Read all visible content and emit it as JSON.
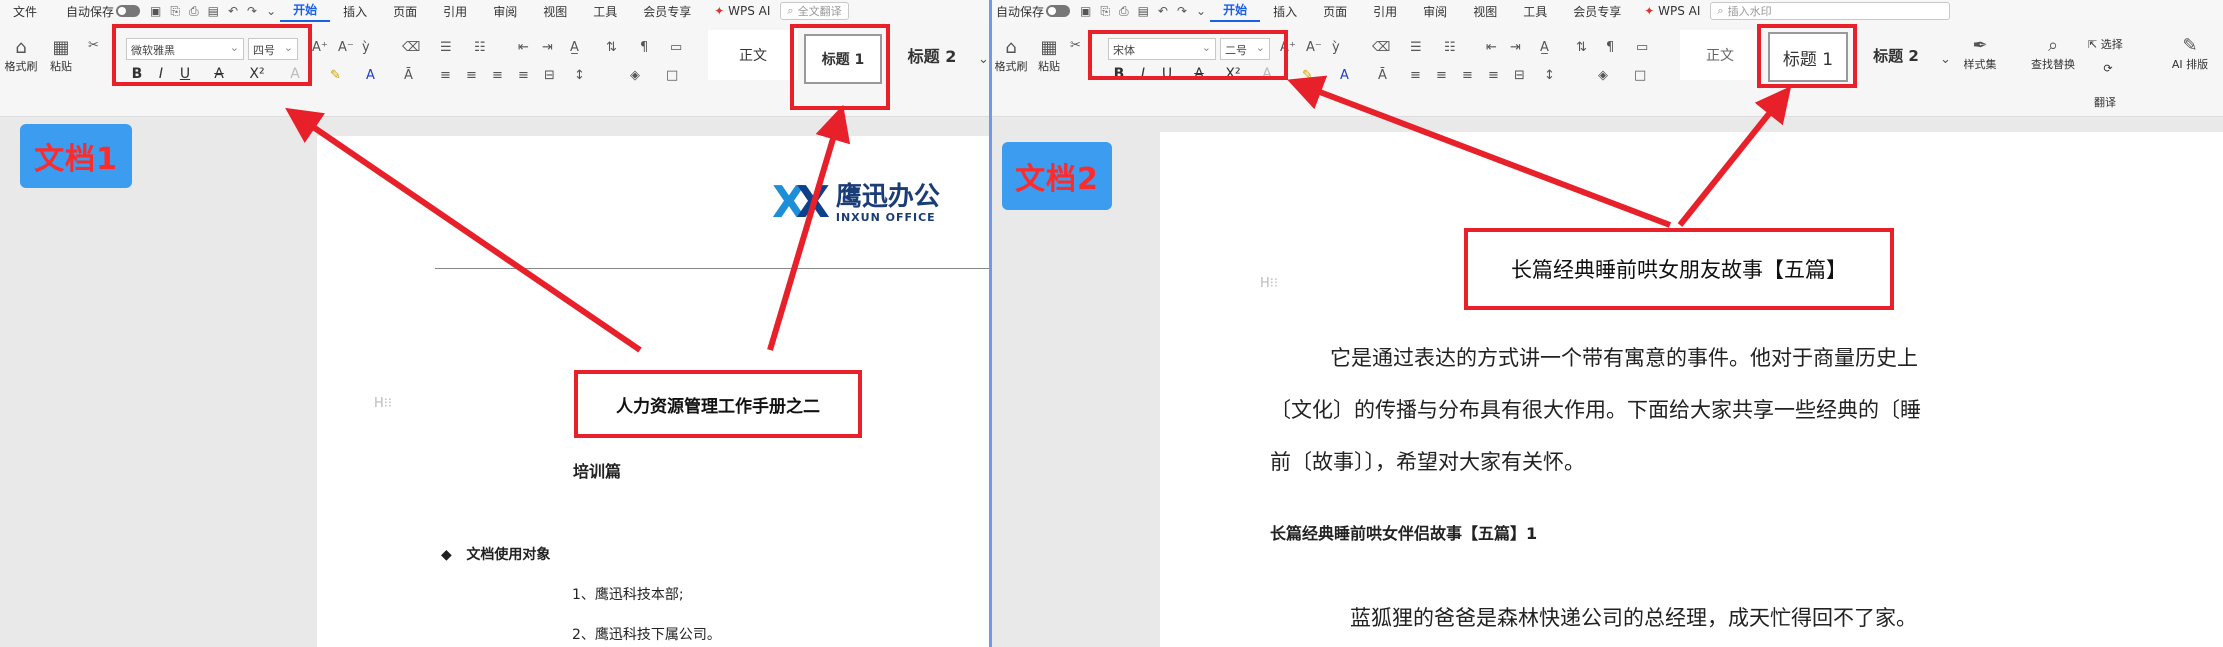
{
  "doc1": {
    "menubar": {
      "file": "文件",
      "autosave": "自动保存",
      "tabs": [
        "开始",
        "插入",
        "页面",
        "引用",
        "审阅",
        "视图",
        "工具",
        "会员专享"
      ],
      "wps_ai": "WPS AI",
      "search_placeholder": "全文翻译"
    },
    "ribbon": {
      "format_painter": "格式刷",
      "paste": "粘贴",
      "font_name": "微软雅黑",
      "font_size": "四号",
      "style_normal": "正文",
      "style_heading1": "标题 1",
      "style_heading2": "标题 2"
    },
    "badge": "文档1",
    "logo": {
      "cn": "鹰迅办公",
      "en": "INXUN OFFICE"
    },
    "title_callout": "人力资源管理工作手册之二",
    "subtitle": "培训篇",
    "bullet_heading": "文档使用对象",
    "list_items": [
      "1、鹰迅科技本部;",
      "2、鹰迅科技下属公司。"
    ]
  },
  "doc2": {
    "menubar": {
      "autosave": "自动保存",
      "tabs": [
        "开始",
        "插入",
        "页面",
        "引用",
        "审阅",
        "视图",
        "工具",
        "会员专享"
      ],
      "wps_ai": "WPS AI",
      "search_placeholder": "插入水印"
    },
    "ribbon": {
      "format_painter": "格式刷",
      "paste": "粘贴",
      "font_name": "宋体",
      "font_size": "二号",
      "style_normal": "正文",
      "style_heading1": "标题 1",
      "style_heading2": "标题 2",
      "style_set": "样式集",
      "find_replace": "查找替换",
      "select": "选择",
      "translate": "翻译",
      "ai_layout": "AI 排版"
    },
    "badge": "文档2",
    "title_callout": "长篇经典睡前哄女朋友故事【五篇】",
    "paragraph_lines": [
      "它是通过表达的方式讲一个带有寓意的事件。他对于商量历史上",
      "〔文化〕的传播与分布具有很大作用。下面给大家共享一些经典的〔睡",
      "前〔故事〕〕，希望对大家有关怀。"
    ],
    "heading": "长篇经典睡前哄女伴侣故事【五篇】1",
    "last_line": "蓝狐狸的爸爸是森林快递公司的总经理，成天忙得回不了家。"
  },
  "colors": {
    "accent_red": "#e8202a",
    "badge_blue": "#3b9cf0",
    "tab_active": "#1a5fe8"
  }
}
